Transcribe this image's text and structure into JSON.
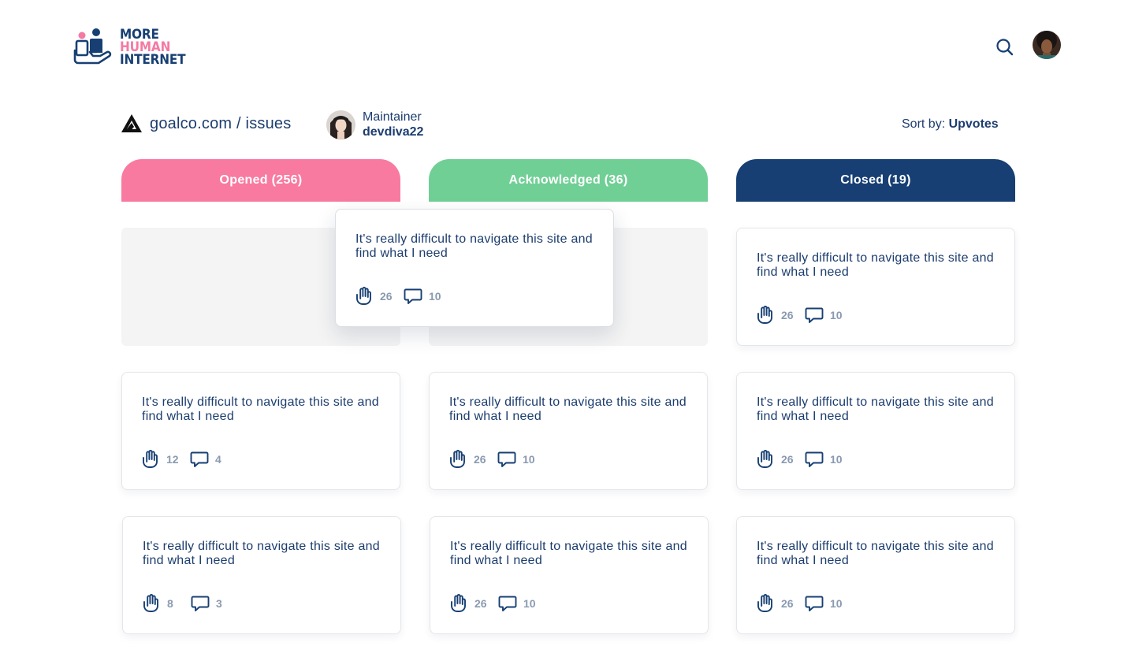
{
  "brand": {
    "line1": "MORE",
    "line2": "HUMAN",
    "line3": "INTERNET",
    "colors": {
      "navy": "#173f73",
      "pink": "#f47aa2"
    }
  },
  "header": {
    "search_icon": "search-icon",
    "avatar": "user-avatar"
  },
  "project": {
    "path": "goalco.com / issues",
    "maintainer_role": "Maintainer",
    "maintainer_name": "devdiva22"
  },
  "sort": {
    "label": "Sort by: ",
    "value": "Upvotes"
  },
  "columns": [
    {
      "label": "Opened (256)",
      "color": "#f87aa0"
    },
    {
      "label": "Acknowledged (36)",
      "color": "#70cf95"
    },
    {
      "label": "Closed (19)",
      "color": "#173f73"
    }
  ],
  "dragging_card": {
    "text": "It's really difficult to navigate this site and find what I need",
    "upvotes": "26",
    "comments": "10"
  },
  "cards": {
    "closed_1": {
      "text": "It's really difficult to navigate this site and find what I need",
      "upvotes": "26",
      "comments": "10"
    },
    "opened_2": {
      "text": "It's really difficult to navigate this site and find what I need",
      "upvotes": "12",
      "comments": "4"
    },
    "ack_2": {
      "text": "It's really difficult to navigate this site and find what I need",
      "upvotes": "26",
      "comments": "10"
    },
    "closed_2": {
      "text": "It's really difficult to navigate this site and find what I need",
      "upvotes": "26",
      "comments": "10"
    },
    "opened_3": {
      "text": "It's really difficult to navigate this site and find what I need",
      "upvotes": "8",
      "comments": "3"
    },
    "ack_3": {
      "text": "It's really difficult to navigate this site and find what I need",
      "upvotes": "26",
      "comments": "10"
    },
    "closed_3": {
      "text": "It's really difficult to navigate this site and find what I need",
      "upvotes": "26",
      "comments": "10"
    }
  }
}
